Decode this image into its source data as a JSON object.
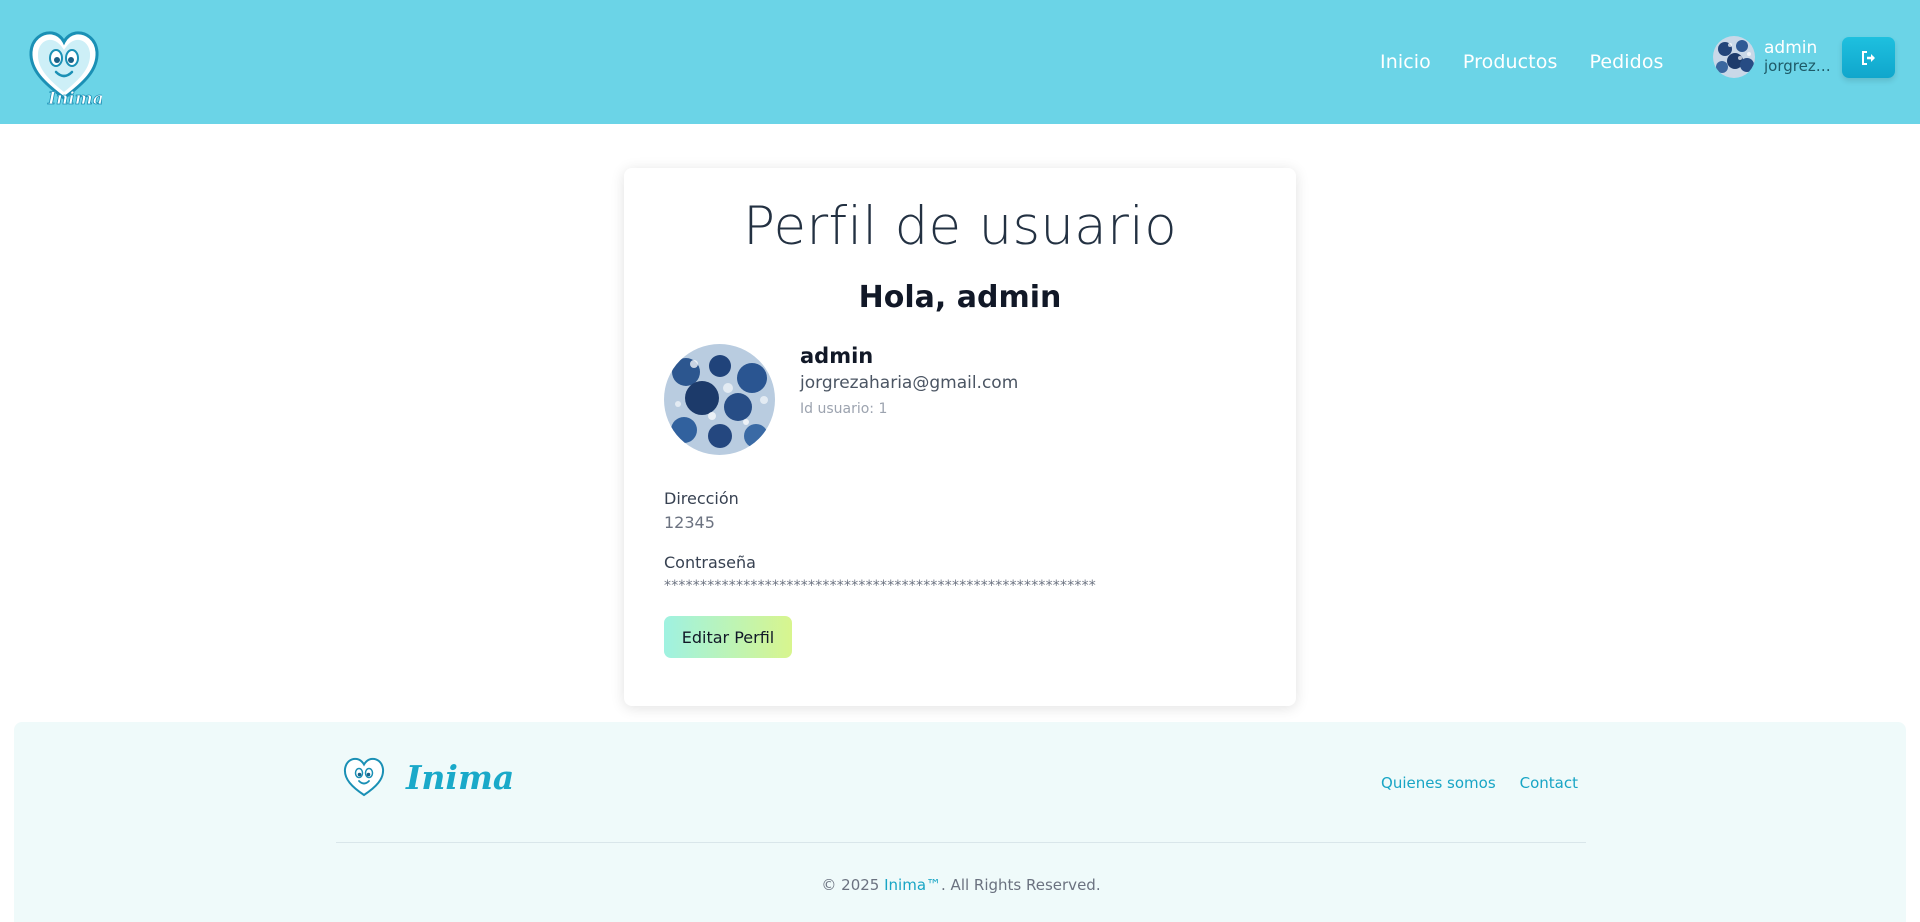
{
  "header": {
    "nav": [
      "Inicio",
      "Productos",
      "Pedidos"
    ],
    "user": {
      "name": "admin",
      "email": "jorgreza..."
    },
    "colors": {
      "header_bg": "#6bd4e7",
      "accent": "#18a5c5"
    },
    "icons": {
      "logout": "sign-out-icon",
      "logo": "heart-mascot-logo"
    }
  },
  "profile": {
    "title": "Perfil de usuario",
    "greeting": "Hola, admin",
    "username": "admin",
    "email": "jorgrezaharia@gmail.com",
    "user_id": "Id usuario: 1",
    "address_label": "Dirección",
    "address_value": "12345",
    "password_label": "Contraseña",
    "password_value": "************************************************************",
    "edit_button": "Editar Perfil"
  },
  "footer": {
    "brand": "Inima",
    "links": [
      "Quienes somos",
      "Contact"
    ],
    "copyright_prefix": "© 2025 ",
    "copyright_brand": "Inima™",
    "copyright_suffix": ". All Rights Reserved."
  }
}
